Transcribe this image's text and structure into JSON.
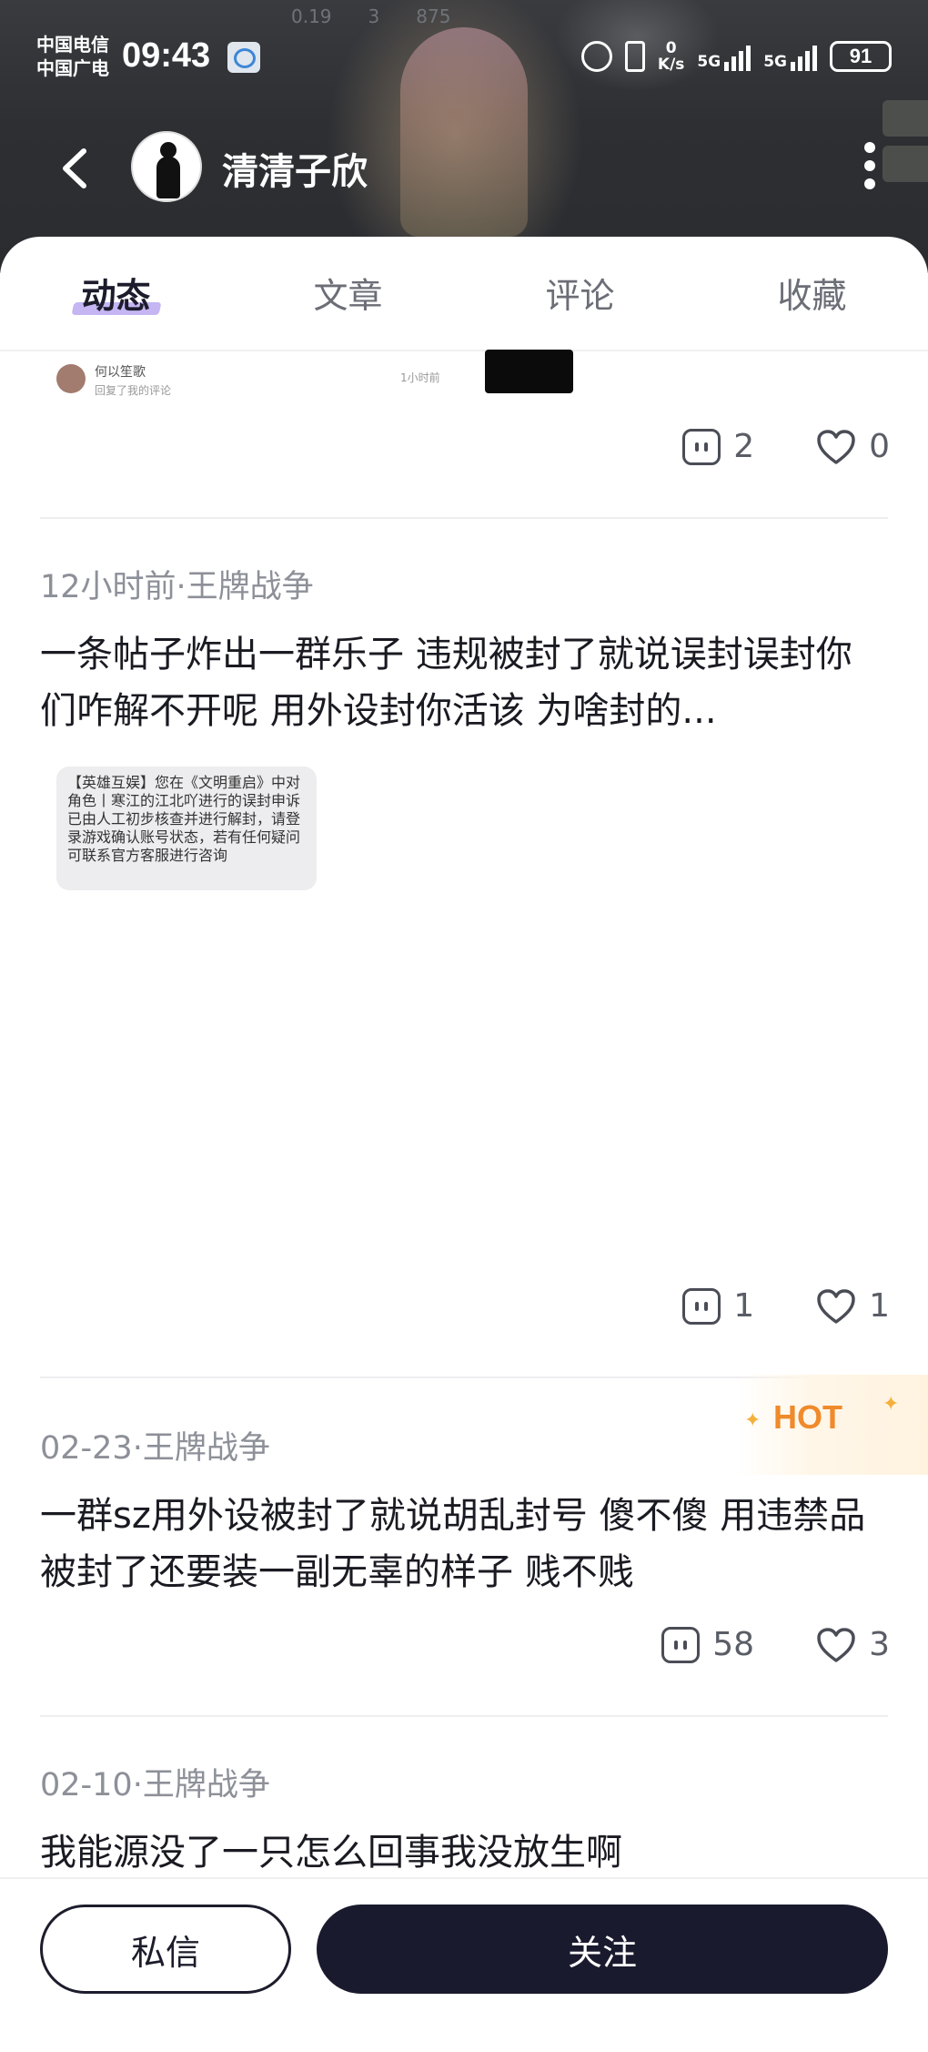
{
  "status_bar": {
    "carrier_1": "中国电信",
    "carrier_2": "中国广电",
    "time": "09:43",
    "net_speed_top": "0",
    "net_speed_bottom": "K/s",
    "signal_1": "5G",
    "signal_2": "5G",
    "battery": "91"
  },
  "header": {
    "bg_strip_1": "0.19",
    "bg_strip_2": "3",
    "bg_strip_3": "875"
  },
  "profile": {
    "name": "清清子欣"
  },
  "tabs": [
    {
      "label": "动态",
      "active": true
    },
    {
      "label": "文章",
      "active": false
    },
    {
      "label": "评论",
      "active": false
    },
    {
      "label": "收藏",
      "active": false
    }
  ],
  "embed_top": {
    "name": "何以笙歌",
    "sub": "回复了我的评论",
    "time": "1小时前"
  },
  "posts": [
    {
      "comments": "2",
      "likes": "0"
    },
    {
      "meta": "12小时前·王牌战争",
      "text": "一条帖子炸出一群乐子 违规被封了就说误封误封你们咋解不开呢 用外设封你活该 为啥封的...",
      "sms_text": "【英雄互娱】您在《文明重启》中对角色丨寒江的江北吖进行的误封申诉已由人工初步核查并进行解封，请登录游戏确认账号状态，若有任何疑问可联系官方客服进行咨询",
      "comments": "1",
      "likes": "1"
    },
    {
      "meta": "02-23·王牌战争",
      "badge": "HOT",
      "text": "一群sz用外设被封了就说胡乱封号 傻不傻 用违禁品被封了还要装一副无辜的样子 贱不贱",
      "comments": "58",
      "likes": "3"
    },
    {
      "meta": "02-10·王牌战争",
      "text": "我能源没了一只怎么回事我没放生啊"
    }
  ],
  "bottom": {
    "message_label": "私信",
    "follow_label": "关注"
  },
  "colors": {
    "accent_underline": "#b6a3f0",
    "follow_button": "#1a1a2e",
    "hot_orange": "#f08a2a"
  },
  "icons": [
    "back-arrow-icon",
    "more-vertical-icon",
    "alarm-icon",
    "vibrate-icon",
    "comment-icon",
    "heart-icon",
    "chat-bubble-icon"
  ]
}
